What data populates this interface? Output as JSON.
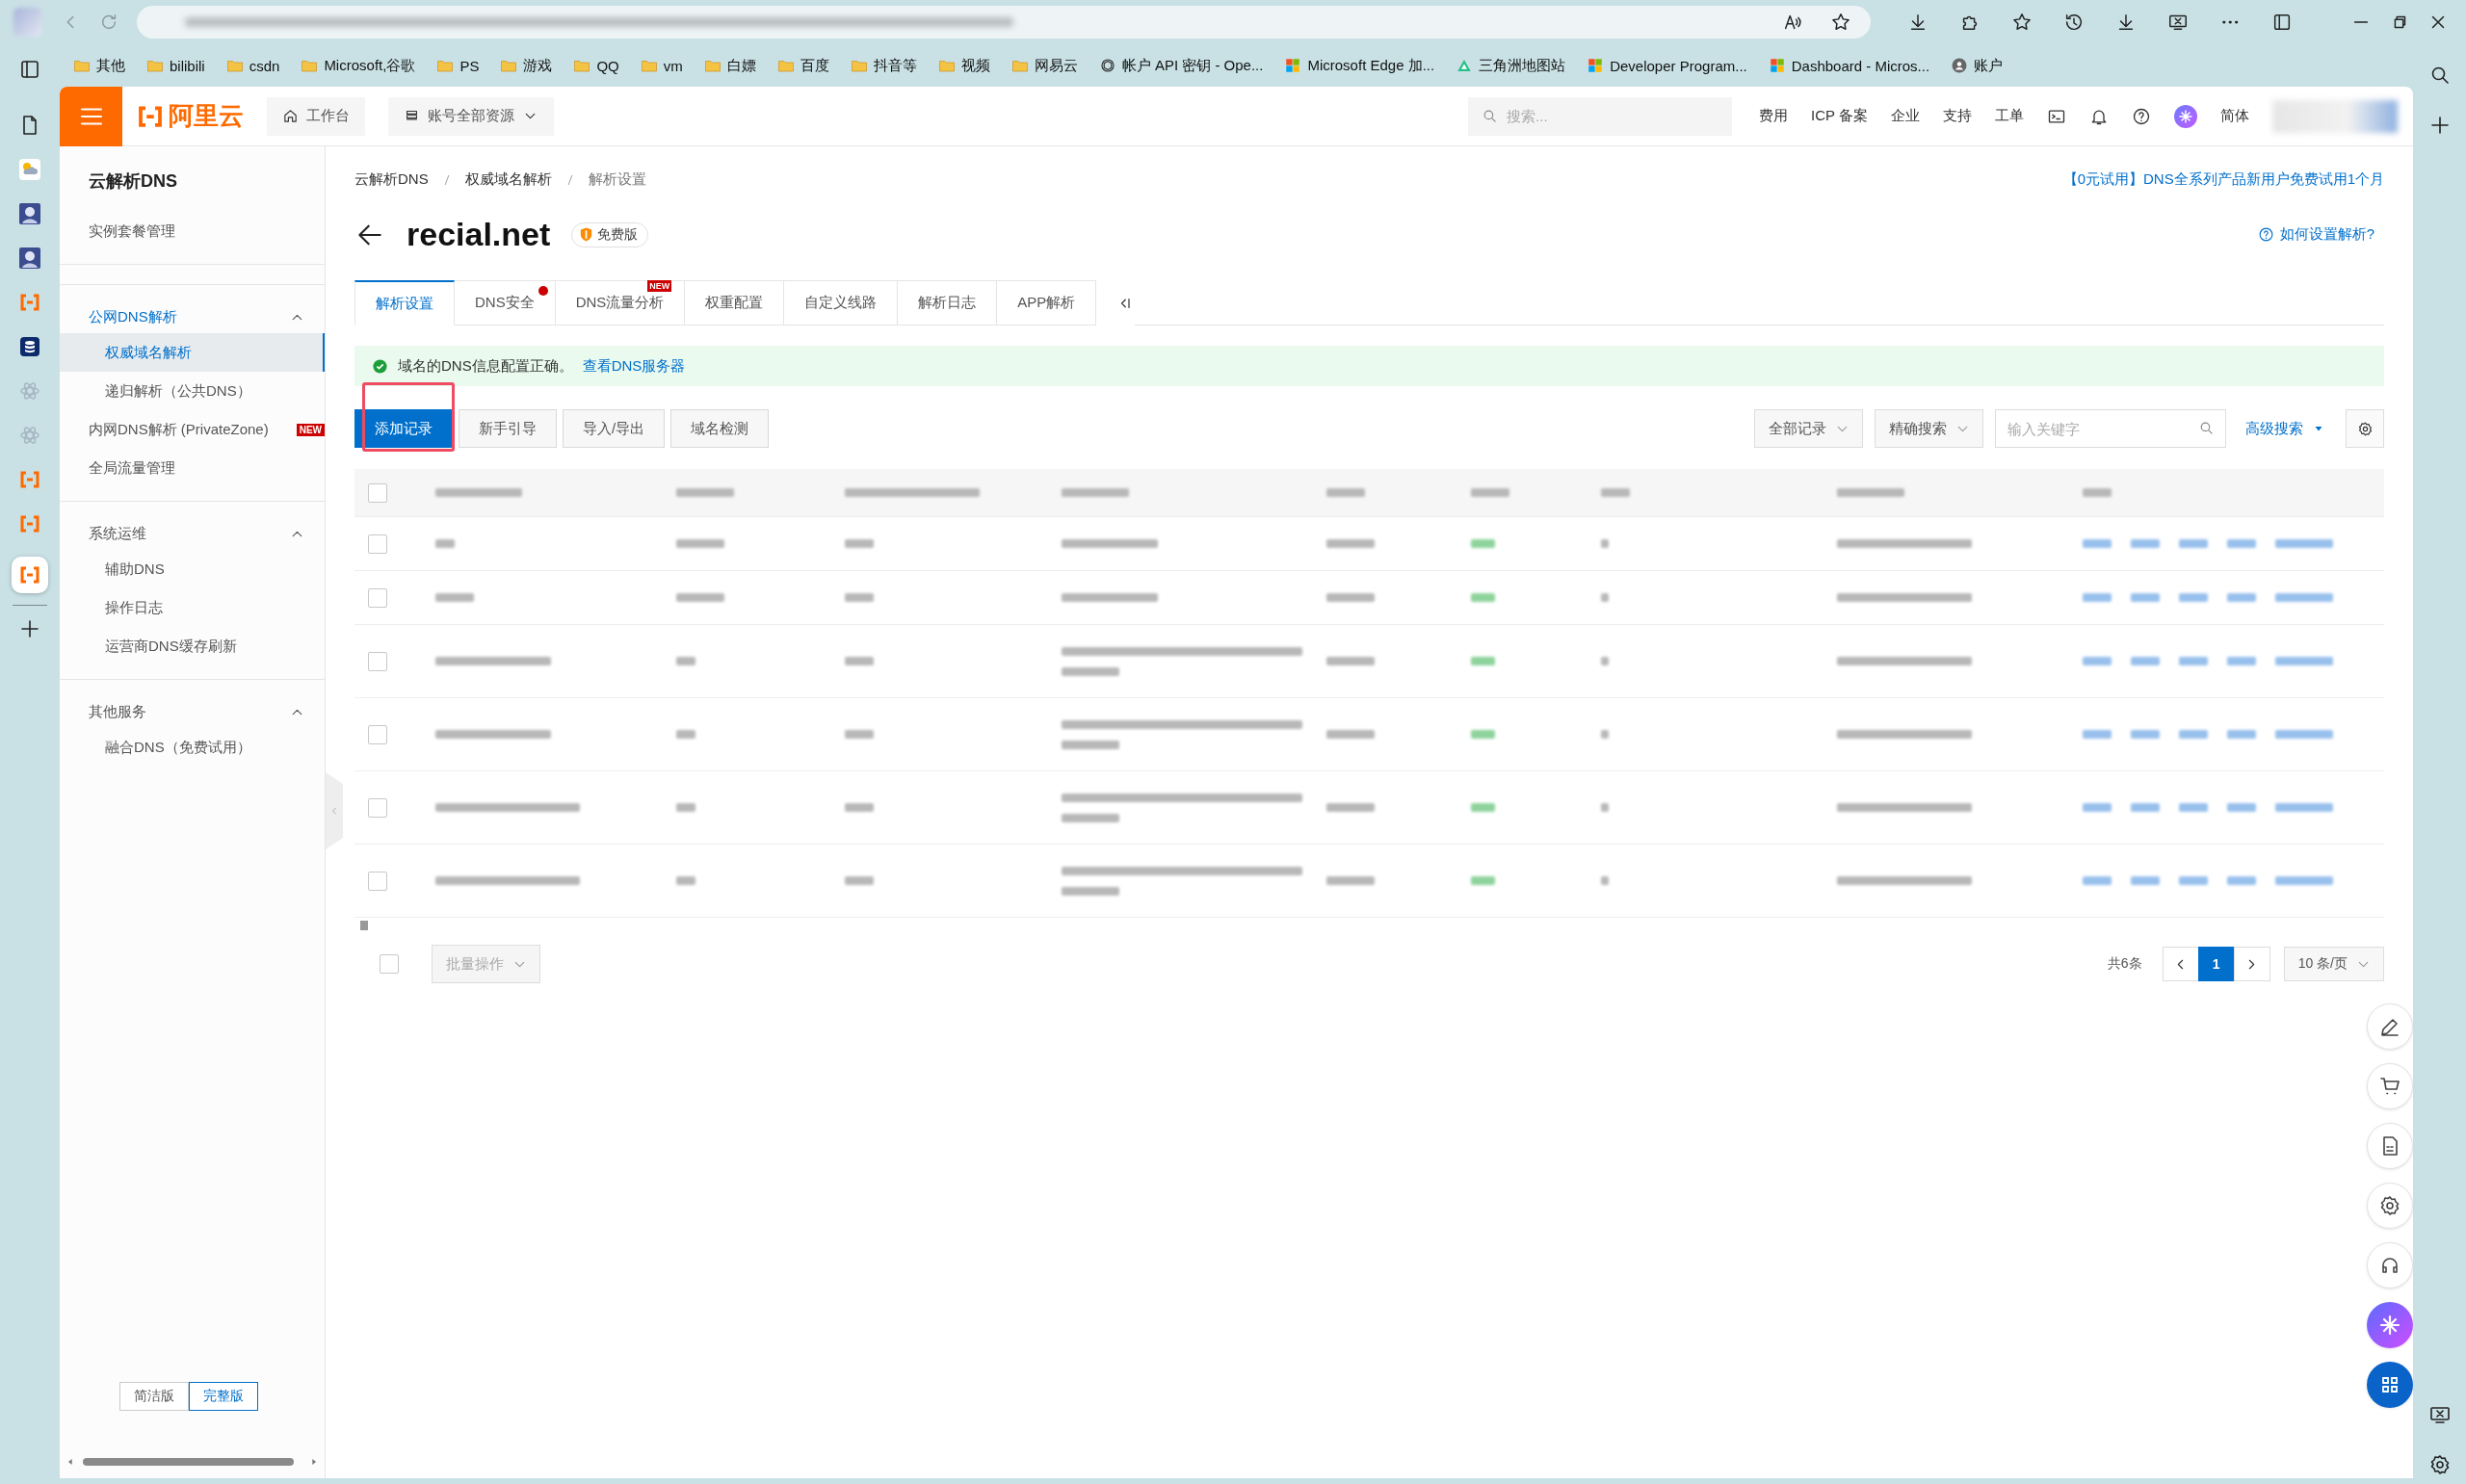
{
  "bookmarks": [
    {
      "label": "其他",
      "kind": "folder"
    },
    {
      "label": "bilibili",
      "kind": "folder"
    },
    {
      "label": "csdn",
      "kind": "folder"
    },
    {
      "label": "Microsoft,谷歌",
      "kind": "folder"
    },
    {
      "label": "PS",
      "kind": "folder"
    },
    {
      "label": "游戏",
      "kind": "folder"
    },
    {
      "label": "QQ",
      "kind": "folder"
    },
    {
      "label": "vm",
      "kind": "folder"
    },
    {
      "label": "白嫖",
      "kind": "folder"
    },
    {
      "label": "百度",
      "kind": "folder"
    },
    {
      "label": "抖音等",
      "kind": "folder"
    },
    {
      "label": "视频",
      "kind": "folder"
    },
    {
      "label": "网易云",
      "kind": "folder"
    },
    {
      "label": "帐户 API 密钥 - Ope...",
      "kind": "openai"
    },
    {
      "label": "Microsoft Edge 加...",
      "kind": "windows"
    },
    {
      "label": "三角洲地图站",
      "kind": "triangle"
    },
    {
      "label": "Developer Program...",
      "kind": "windows"
    },
    {
      "label": "Dashboard - Micros...",
      "kind": "windows"
    },
    {
      "label": "账户",
      "kind": "account"
    }
  ],
  "header": {
    "logo": "阿里云",
    "workbench": "工作台",
    "resources": "账号全部资源",
    "search": {
      "placeholder": "搜索..."
    },
    "links": [
      "费用",
      "ICP 备案",
      "企业",
      "支持",
      "工单"
    ],
    "language": "简体"
  },
  "sidebar": {
    "title": "云解析DNS",
    "items": [
      {
        "kind": "link",
        "label": "实例套餐管理",
        "selected": false
      },
      {
        "kind": "group",
        "label": "公网DNS解析",
        "expanded": true,
        "active": true,
        "children": [
          {
            "label": "权威域名解析",
            "selected": true
          },
          {
            "label": "递归解析（公共DNS）",
            "selected": false
          }
        ]
      },
      {
        "kind": "link",
        "label": "内网DNS解析 (PrivateZone)",
        "selected": false,
        "badge": "NEW"
      },
      {
        "kind": "link",
        "label": "全局流量管理",
        "selected": false
      },
      {
        "kind": "group",
        "label": "系统运维",
        "expanded": true,
        "active": false,
        "children": [
          {
            "label": "辅助DNS",
            "selected": false
          },
          {
            "label": "操作日志",
            "selected": false
          },
          {
            "label": "运营商DNS缓存刷新",
            "selected": false
          }
        ]
      },
      {
        "kind": "group",
        "label": "其他服务",
        "expanded": true,
        "active": false,
        "children": [
          {
            "label": "融合DNS（免费试用）",
            "selected": false
          }
        ]
      }
    ],
    "view_modes": [
      {
        "label": "简洁版",
        "selected": false
      },
      {
        "label": "完整版",
        "selected": true
      }
    ]
  },
  "breadcrumb": [
    "云解析DNS",
    "权威域名解析",
    "解析设置"
  ],
  "promo_link": "【0元试用】DNS全系列产品新用户免费试用1个月",
  "domain": "recial.net",
  "plan_badge": "免费版",
  "help_link": "如何设置解析?",
  "tabs": [
    {
      "label": "解析设置",
      "selected": true,
      "dot": false
    },
    {
      "label": "DNS安全",
      "selected": false,
      "dot": true
    },
    {
      "label": "DNS流量分析",
      "selected": false,
      "dot": false,
      "badge": "NEW"
    },
    {
      "label": "权重配置",
      "selected": false,
      "dot": false
    },
    {
      "label": "自定义线路",
      "selected": false,
      "dot": false
    },
    {
      "label": "解析日志",
      "selected": false,
      "dot": false
    },
    {
      "label": "APP解析",
      "selected": false,
      "dot": false
    }
  ],
  "alert": {
    "message": "域名的DNS信息配置正确。",
    "link": "查看DNS服务器"
  },
  "actions": [
    {
      "label": "添加记录",
      "primary": true,
      "highlighted": true
    },
    {
      "label": "新手引导",
      "primary": false,
      "highlighted": false
    },
    {
      "label": "导入/导出",
      "primary": false,
      "highlighted": false
    },
    {
      "label": "域名检测",
      "primary": false,
      "highlighted": false
    }
  ],
  "filters": {
    "record_type": "全部记录",
    "search_mode": "精确搜索",
    "keyword": {
      "placeholder": "输入关键字"
    },
    "advanced": "高级搜索"
  },
  "table": {
    "all_checked": false,
    "rows": [
      {
        "kind": "single",
        "checked": false
      },
      {
        "kind": "single",
        "checked": false
      },
      {
        "kind": "double",
        "checked": false
      },
      {
        "kind": "double",
        "checked": false
      },
      {
        "kind": "double",
        "checked": false
      },
      {
        "kind": "double",
        "checked": false
      }
    ]
  },
  "footer": {
    "select_all_checked": false,
    "batch": "批量操作",
    "total": "共6条",
    "pages": [
      {
        "label": "1",
        "selected": true
      }
    ],
    "page_size": "10 条/页"
  }
}
